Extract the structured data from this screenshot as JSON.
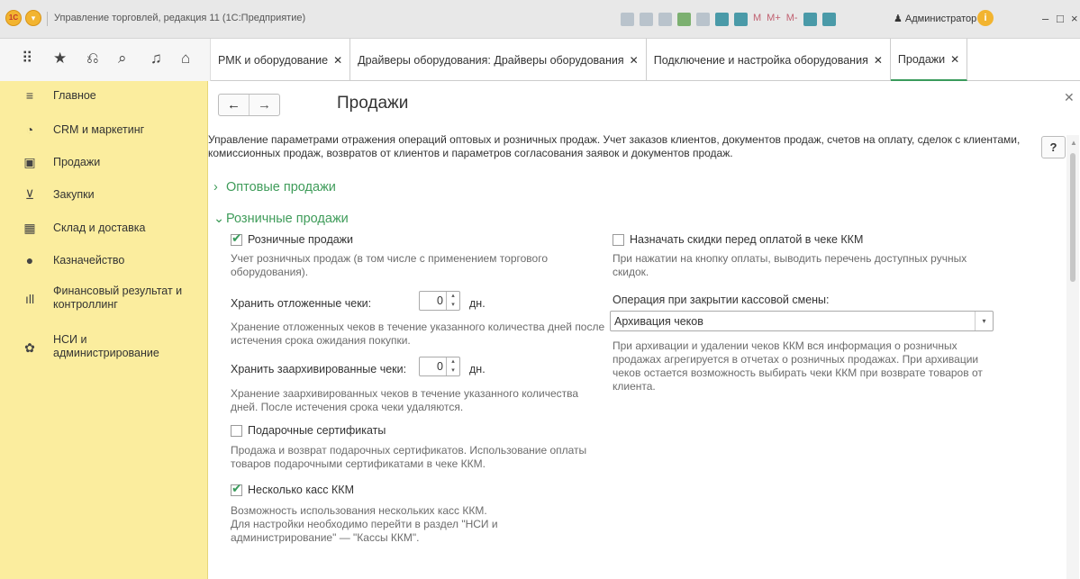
{
  "window": {
    "title": "Управление торговлей, редакция 11  (1С:Предприятие)",
    "user": "Администратор",
    "mem_labels": [
      "M",
      "M+",
      "M-"
    ]
  },
  "tabs": [
    {
      "label": "РМК и оборудование"
    },
    {
      "label": "Драйверы оборудования: Драйверы оборудования"
    },
    {
      "label": "Подключение и настройка оборудования"
    },
    {
      "label": "Продажи"
    }
  ],
  "sidebar": {
    "items": [
      {
        "label": "Главное",
        "icon": "menu-lines-icon"
      },
      {
        "label": "CRM и маркетинг",
        "icon": "pie-chart-icon"
      },
      {
        "label": "Продажи",
        "icon": "shopping-bag-icon"
      },
      {
        "label": "Закупки",
        "icon": "cart-icon"
      },
      {
        "label": "Склад и доставка",
        "icon": "warehouse-icon"
      },
      {
        "label": "Казначейство",
        "icon": "ruble-coin-icon"
      },
      {
        "label": "Финансовый результат и контроллинг",
        "icon": "bar-chart-icon"
      },
      {
        "label": "НСИ и администрирование",
        "icon": "gear-icon"
      }
    ]
  },
  "page": {
    "title": "Продажи",
    "description": "Управление параметрами отражения операций оптовых и розничных продаж. Учет заказов клиентов, документов продаж, счетов на оплату, сделок с клиентами, комиссионных продаж, возвратов от клиентов и параметров согласования заявок и документов продаж.",
    "help_label": "?"
  },
  "sections": {
    "wholesale": {
      "label": "Оптовые продажи",
      "expanded": false
    },
    "retail": {
      "label": "Розничные продажи",
      "expanded": true
    }
  },
  "retail": {
    "retail_sales": {
      "label": "Розничные продажи",
      "checked": true,
      "note": "Учет розничных продаж (в том числе с применением торгового оборудования)."
    },
    "keep_deferred": {
      "label": "Хранить отложенные чеки:",
      "value": "0",
      "unit": "дн.",
      "note": "Хранение отложенных чеков в течение указанного количества дней после истечения срока ожидания покупки."
    },
    "keep_archived": {
      "label": "Хранить заархивированные чеки:",
      "value": "0",
      "unit": "дн.",
      "note": "Хранение заархивированных чеков в течение указанного количества дней. После истечения срока чеки удаляются."
    },
    "gift_certificates": {
      "label": "Подарочные сертификаты",
      "checked": false,
      "note": "Продажа и возврат подарочных сертификатов. Использование оплаты товаров подарочными сертификатами в чеке ККМ."
    },
    "multiple_registers": {
      "label": "Несколько касс ККМ",
      "checked": true,
      "note_lines": [
        "Возможность использования нескольких касс ККМ.",
        "Для настройки необходимо перейти в раздел \"НСИ и",
        "администрирование\" — \"Кассы ККМ\"."
      ]
    },
    "discounts_before_payment": {
      "label": "Назначать скидки перед оплатой в чеке ККМ",
      "checked": false,
      "note": "При нажатии на кнопку оплаты, выводить перечень доступных ручных скидок."
    },
    "shift_close_operation": {
      "label": "Операция при закрытии кассовой смены:",
      "value": "Архивация чеков",
      "note": "При архивации и удалении чеков ККМ вся информация о розничных продажах агрегируется в отчетах о розничных продажах. При архивации чеков остается возможность выбирать чеки ККМ при возврате товаров от клиента."
    }
  },
  "colors": {
    "sidebar_bg": "#fbed9e",
    "accent_green": "#3f9c5a",
    "note_gray": "#6c6c6c"
  }
}
